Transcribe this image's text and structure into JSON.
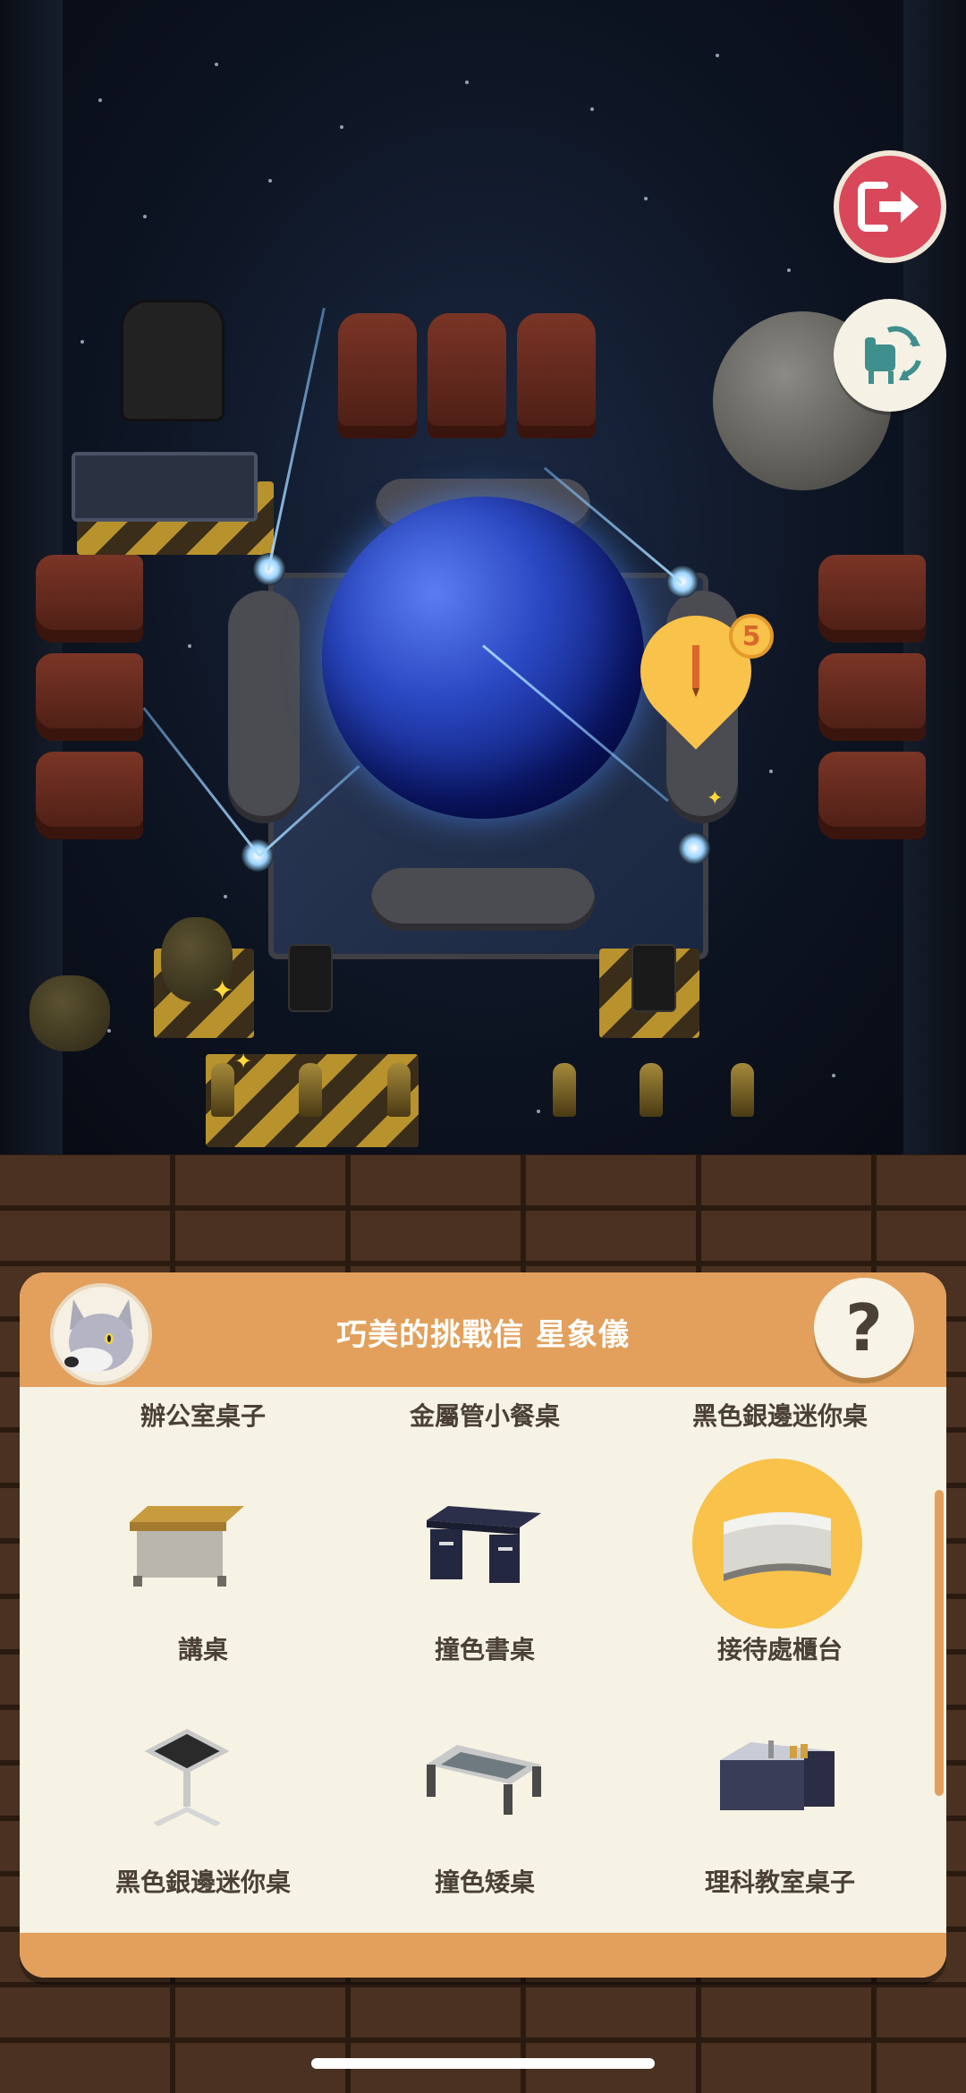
{
  "scene": {
    "marker_count": "5"
  },
  "buttons": {
    "exit_icon": "exit-door-icon",
    "swap_icon": "chair-swap-icon",
    "help_label": "?"
  },
  "panel": {
    "title": "巧美的挑戰信 星象儀",
    "items": [
      {
        "label": "辦公室桌子"
      },
      {
        "label": "金屬管小餐桌"
      },
      {
        "label": "黑色銀邊迷你桌"
      },
      {
        "label": "講桌"
      },
      {
        "label": "撞色書桌"
      },
      {
        "label": "接待處櫃台",
        "selected": true
      },
      {
        "label": "黑色銀邊迷你桌"
      },
      {
        "label": "撞色矮桌"
      },
      {
        "label": "理科教室桌子"
      }
    ]
  },
  "colors": {
    "panel_accent": "#e2a05c",
    "selected_halo": "#f8c24b",
    "exit_button": "#d9475a",
    "panel_bg": "#f6f2e4"
  }
}
